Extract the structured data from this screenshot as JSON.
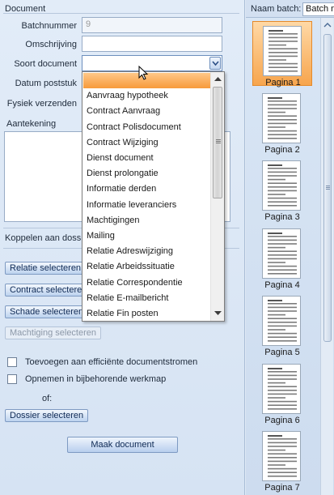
{
  "document": {
    "group_title": "Document",
    "batchnummer_label": "Batchnummer",
    "batchnummer_value": "9",
    "omschrijving_label": "Omschrijving",
    "omschrijving_value": "",
    "soort_document_label": "Soort document",
    "datum_poststuk_label": "Datum poststuk",
    "fysiek_verzenden_label": "Fysiek verzenden",
    "aantekening_label": "Aantekening"
  },
  "koppelen": {
    "label": "Koppelen aan dossie",
    "buttons": {
      "relatie": "Relatie selecteren",
      "contract": "Contract selecteren",
      "schade": "Schade selecteren",
      "machtiging": "Machtiging selecteren"
    }
  },
  "options": {
    "toevoegen": "Toevoegen aan efficiënte documentstromen",
    "opnemen": "Opnemen in bijbehorende werkmap",
    "of": "of:",
    "dossier_button": "Dossier selecteren"
  },
  "maak_button": "Maak document",
  "dropdown": {
    "items": [
      "",
      "Aanvraag hypotheek",
      "Contract Aanvraag",
      "Contract Polisdocument",
      "Contract Wijziging",
      "Dienst document",
      "Dienst prolongatie",
      "Informatie derden",
      "Informatie leveranciers",
      "Machtigingen",
      "Mailing",
      "Relatie Adreswijziging",
      "Relatie Arbeidssituatie",
      "Relatie Correspondentie",
      "Relatie E-mailbericht",
      "Relatie Fin posten"
    ],
    "selected_index": 0
  },
  "batch_panel": {
    "naam_label": "Naam batch:",
    "naam_value": "Batch m",
    "pages": [
      "Pagina 1",
      "Pagina 2",
      "Pagina 3",
      "Pagina 4",
      "Pagina 5",
      "Pagina 6",
      "Pagina 7"
    ],
    "selected_page": 0
  },
  "colors": {
    "selection": "#f79a3b",
    "button_text": "#0f2a55",
    "panel_bg": "#dfe9f5"
  }
}
